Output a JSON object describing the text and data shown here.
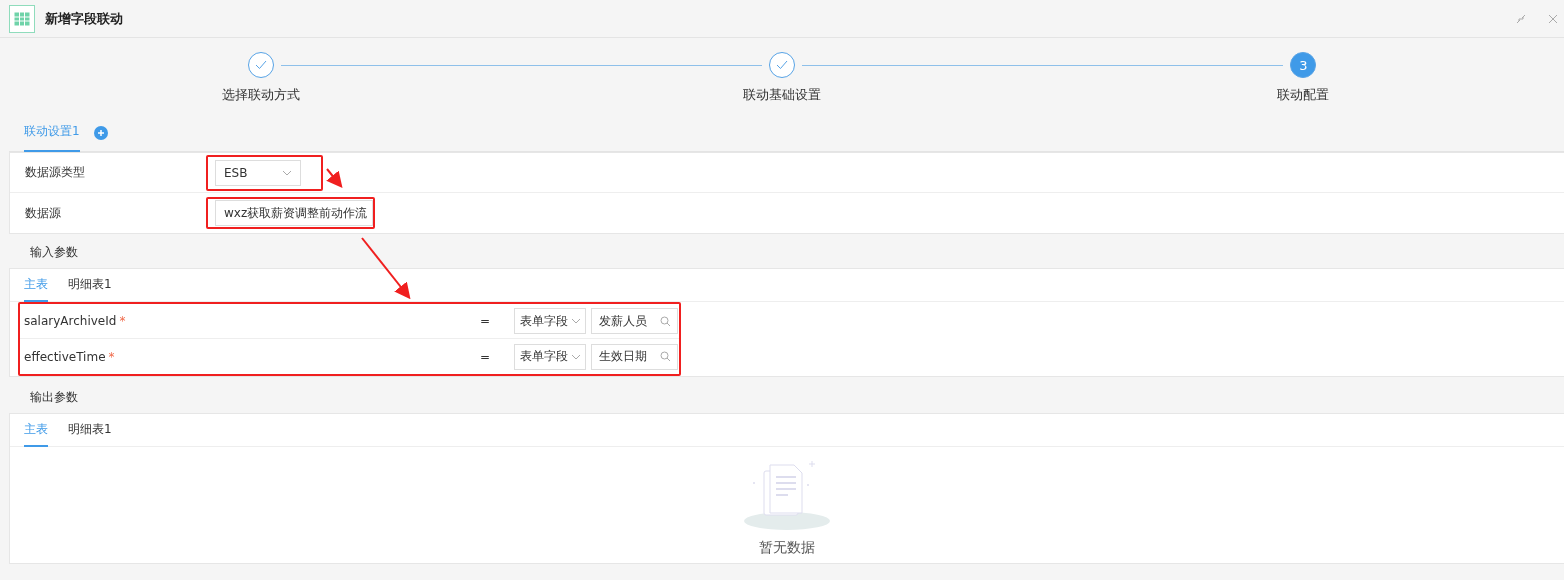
{
  "window": {
    "title": "新增字段联动"
  },
  "steps": [
    {
      "label": "选择联动方式",
      "kind": "done"
    },
    {
      "label": "联动基础设置",
      "kind": "done"
    },
    {
      "label": "联动配置",
      "kind": "current",
      "number": "3"
    }
  ],
  "config_tabs": [
    {
      "label": "联动设置1",
      "selected": true
    }
  ],
  "form_fields": [
    {
      "label": "数据源类型",
      "kind": "select",
      "value": "ESB",
      "highlighted": true
    },
    {
      "label": "数据源",
      "kind": "search",
      "value": "wxz获取薪资调整前动作流",
      "highlighted": true
    }
  ],
  "input_params": {
    "title": "输入参数",
    "tabs": [
      {
        "label": "主表",
        "selected": true
      },
      {
        "label": "明细表1",
        "selected": false
      }
    ],
    "highlighted": true,
    "rows": [
      {
        "name": "salaryArchiveId",
        "required_mark": "*",
        "operator": "=",
        "source": "表单字段",
        "value": "发薪人员"
      },
      {
        "name": "effectiveTime",
        "required_mark": "*",
        "operator": "=",
        "source": "表单字段",
        "value": "生效日期"
      }
    ]
  },
  "output_params": {
    "title": "输出参数",
    "tabs": [
      {
        "label": "主表",
        "selected": true
      },
      {
        "label": "明细表1",
        "selected": false
      }
    ],
    "empty_text": "暂无数据"
  }
}
